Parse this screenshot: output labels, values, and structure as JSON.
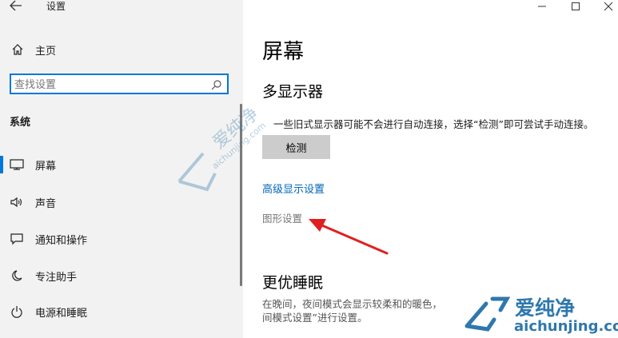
{
  "window": {
    "title": "设置",
    "back_icon": "back-arrow-icon",
    "controls": [
      "minimize-icon",
      "maximize-icon",
      "close-icon"
    ]
  },
  "sidebar": {
    "home_label": "主页",
    "search_placeholder": "查找设置",
    "section_title": "系统",
    "items": [
      {
        "label": "屏幕",
        "icon": "monitor-icon",
        "selected": true
      },
      {
        "label": "声音",
        "icon": "speaker-icon",
        "selected": false
      },
      {
        "label": "通知和操作",
        "icon": "notification-icon",
        "selected": false
      },
      {
        "label": "专注助手",
        "icon": "moon-icon",
        "selected": false
      },
      {
        "label": "电源和睡眠",
        "icon": "power-icon",
        "selected": false
      }
    ]
  },
  "main": {
    "page_title": "屏幕",
    "multi_display": {
      "heading": "多显示器",
      "description": "一些旧式显示器可能不会进行自动连接，选择“检测”即可尝试手动连接。",
      "detect_button": "检测"
    },
    "advanced_link": "高级显示设置",
    "graphics_link": "图形设置",
    "night_light": {
      "heading": "更优睡眠",
      "text_line1": "在晚间，夜间模式会显示较柔和的暖色，",
      "text_line2": "间模式设置”进行设置。"
    }
  },
  "watermark": {
    "brand": "爱纯净",
    "url": "aichunjing.com"
  },
  "colors": {
    "accent": "#0078d7",
    "link": "#0067b8",
    "arrow": "#e02020",
    "watermark": "#2f78ad"
  }
}
